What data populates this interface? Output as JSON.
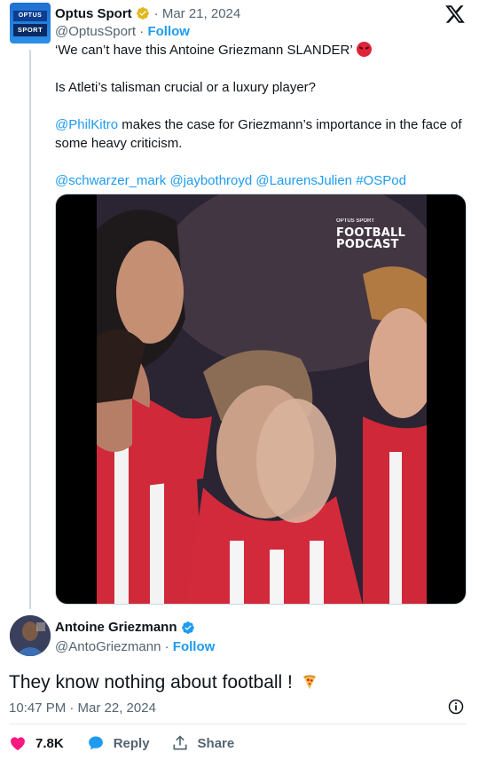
{
  "parent_tweet": {
    "avatar_text_top": "OPTUS",
    "avatar_text_bottom": "SPORT",
    "author_name": "Optus Sport",
    "separator": "·",
    "date": "Mar 21, 2024",
    "handle": "@OptusSport",
    "follow_label": "Follow",
    "line1": "‘We can’t have this Antoine Griezmann SLANDER’",
    "line2": "Is Atleti’s talisman crucial or a luxury player?",
    "line3_mention": "@PhilKitro",
    "line3_rest": " makes the case for Griezmann’s importance in the face of some heavy criticism.",
    "tags": [
      "@schwarzer_mark",
      "@jaybothroyd",
      "@LaurensJulien",
      "#OSPod"
    ],
    "media": {
      "overlay_small": "OPTUS SPORT",
      "overlay_line1": "FOOTBALL",
      "overlay_line2": "PODCAST"
    }
  },
  "reply_tweet": {
    "author_name": "Antoine Griezmann",
    "handle": "@AntoGriezmann",
    "separator": "·",
    "follow_label": "Follow",
    "text": "They know nothing about football !",
    "timestamp": "10:47 PM · Mar 22, 2024",
    "likes": "7.8K",
    "reply_label": "Reply",
    "share_label": "Share"
  },
  "colors": {
    "link": "#1d9bf0",
    "secondary_text": "#536471",
    "like_heart": "#f91880",
    "verified_gold": "#e2b719",
    "verified_blue": "#1d9bf0"
  },
  "icons": [
    "x-logo",
    "gold-verified-badge",
    "blue-verified-badge",
    "angry-face-emoji",
    "pizza-emoji",
    "info-icon",
    "heart-icon",
    "reply-bubble-icon",
    "share-icon"
  ]
}
